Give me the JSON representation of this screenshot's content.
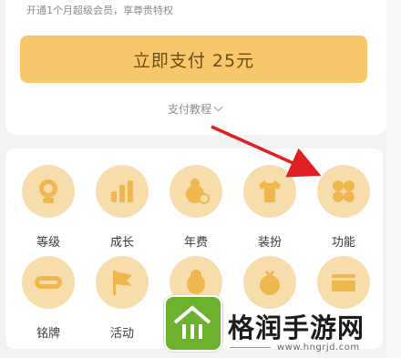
{
  "header_note": "开通1个月超级会员，享尊贵特权",
  "pay_button": "立即支付 25元",
  "tutorial_link": "支付教程",
  "grid": [
    {
      "label": "等级",
      "icon": "level-icon"
    },
    {
      "label": "成长",
      "icon": "growth-icon"
    },
    {
      "label": "年费",
      "icon": "annual-fee-icon"
    },
    {
      "label": "装扮",
      "icon": "dressup-icon"
    },
    {
      "label": "功能",
      "icon": "features-icon"
    },
    {
      "label": "铭牌",
      "icon": "nameplate-svip-icon"
    },
    {
      "label": "活动",
      "icon": "activity-flag-icon"
    },
    {
      "label": "",
      "icon": "penguin-icon"
    },
    {
      "label": "",
      "icon": "gift-icon"
    },
    {
      "label": "",
      "icon": "card-icon"
    }
  ],
  "watermark": {
    "name": "格润手游网",
    "url": "www.hngrjd.com"
  },
  "colors": {
    "pay_button": "#f6c86a",
    "icon_bg": "#f8ddac",
    "icon_fg": "#f0b74f",
    "annotation_arrow": "#e02020"
  }
}
